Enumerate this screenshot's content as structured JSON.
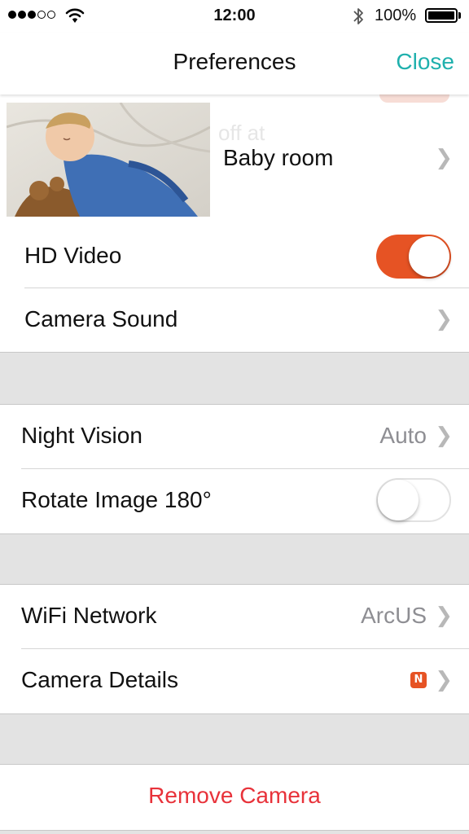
{
  "status_bar": {
    "time": "12:00",
    "battery_percent": "100%",
    "signal_bars_filled": 3,
    "signal_bars_total": 5
  },
  "nav": {
    "title": "Preferences",
    "close_label": "Close"
  },
  "camera": {
    "name": "Baby room",
    "obscured_text": "off at"
  },
  "settings": {
    "hd_video": {
      "label": "HD Video",
      "enabled": true
    },
    "camera_sound": {
      "label": "Camera Sound"
    },
    "night_vision": {
      "label": "Night Vision",
      "value": "Auto"
    },
    "rotate_image": {
      "label": "Rotate Image 180°",
      "enabled": false
    },
    "wifi_network": {
      "label": "WiFi Network",
      "value": "ArcUS"
    },
    "camera_details": {
      "label": "Camera Details",
      "badge": "N"
    }
  },
  "remove_camera_label": "Remove Camera",
  "colors": {
    "accent_teal": "#1fb0ad",
    "toggle_on": "#e65324",
    "destructive": "#e8323a",
    "group_background": "#e3e3e3"
  },
  "icons": {
    "chevron": "chevron-right-icon",
    "wifi": "wifi-icon",
    "bluetooth": "bluetooth-icon",
    "battery": "battery-icon"
  }
}
